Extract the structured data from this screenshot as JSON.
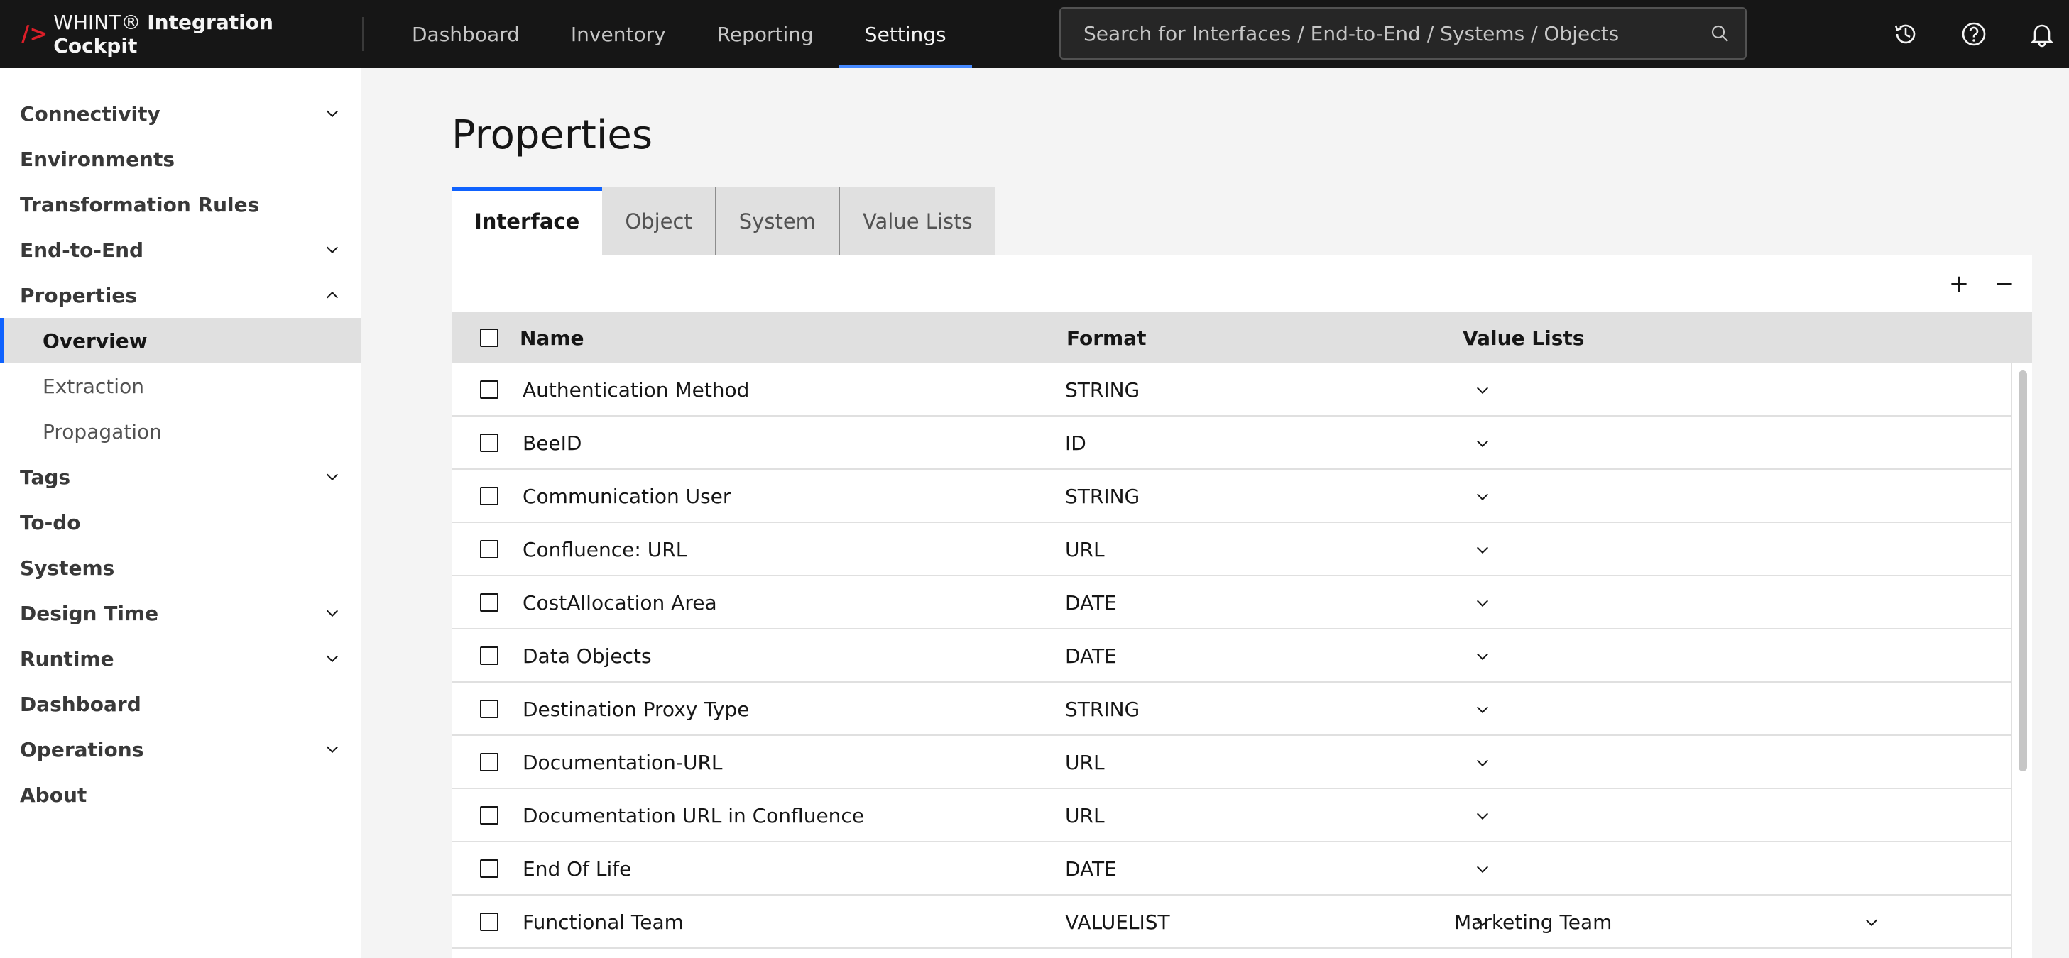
{
  "header": {
    "brand_mark": "/>",
    "brand_plain": "WHINT®",
    "brand_bold": "Integration Cockpit",
    "nav": [
      {
        "label": "Dashboard",
        "active": false
      },
      {
        "label": "Inventory",
        "active": false
      },
      {
        "label": "Reporting",
        "active": false
      },
      {
        "label": "Settings",
        "active": true
      }
    ],
    "search_placeholder": "Search for Interfaces / End-to-End / Systems / Objects",
    "icons": [
      "history-icon",
      "help-icon",
      "notification-icon"
    ]
  },
  "sidebar": {
    "items": [
      {
        "label": "Connectivity",
        "chevron": "down"
      },
      {
        "label": "Environments",
        "chevron": ""
      },
      {
        "label": "Transformation Rules",
        "chevron": ""
      },
      {
        "label": "End-to-End",
        "chevron": "down"
      },
      {
        "label": "Properties",
        "chevron": "up"
      },
      {
        "label": "Overview",
        "sub": true,
        "selected": true
      },
      {
        "label": "Extraction",
        "sub": true
      },
      {
        "label": "Propagation",
        "sub": true
      },
      {
        "label": "Tags",
        "chevron": "down"
      },
      {
        "label": "To-do",
        "chevron": ""
      },
      {
        "label": "Systems",
        "chevron": ""
      },
      {
        "label": "Design Time",
        "chevron": "down"
      },
      {
        "label": "Runtime",
        "chevron": "down"
      },
      {
        "label": "Dashboard",
        "chevron": ""
      },
      {
        "label": "Operations",
        "chevron": "down"
      },
      {
        "label": "About",
        "chevron": ""
      }
    ]
  },
  "main": {
    "title": "Properties",
    "tabs": [
      {
        "label": "Interface",
        "active": true
      },
      {
        "label": "Object",
        "active": false
      },
      {
        "label": "System",
        "active": false
      },
      {
        "label": "Value Lists",
        "active": false
      }
    ],
    "toolbar": {
      "add": "+",
      "remove": "−"
    },
    "columns": {
      "name": "Name",
      "format": "Format",
      "value_lists": "Value Lists"
    },
    "rows": [
      {
        "name": "Authentication Method",
        "format": "STRING",
        "value_list": ""
      },
      {
        "name": "BeeID",
        "format": "ID",
        "value_list": ""
      },
      {
        "name": "Communication User",
        "format": "STRING",
        "value_list": ""
      },
      {
        "name": "Confluence: URL",
        "format": "URL",
        "value_list": ""
      },
      {
        "name": "CostAllocation Area",
        "format": "DATE",
        "value_list": ""
      },
      {
        "name": "Data Objects",
        "format": "DATE",
        "value_list": ""
      },
      {
        "name": "Destination Proxy Type",
        "format": "STRING",
        "value_list": ""
      },
      {
        "name": "Documentation-URL",
        "format": "URL",
        "value_list": ""
      },
      {
        "name": "Documentation URL in Confluence",
        "format": "URL",
        "value_list": ""
      },
      {
        "name": "End Of Life",
        "format": "DATE",
        "value_list": ""
      },
      {
        "name": "Functional Team",
        "format": "VALUELIST",
        "value_list": "Marketing Team"
      }
    ]
  },
  "colors": {
    "accent": "#0f62fe",
    "header_bg": "#161616",
    "active_nav_underline": "#4589ff",
    "brand_mark": "#da1e28"
  }
}
